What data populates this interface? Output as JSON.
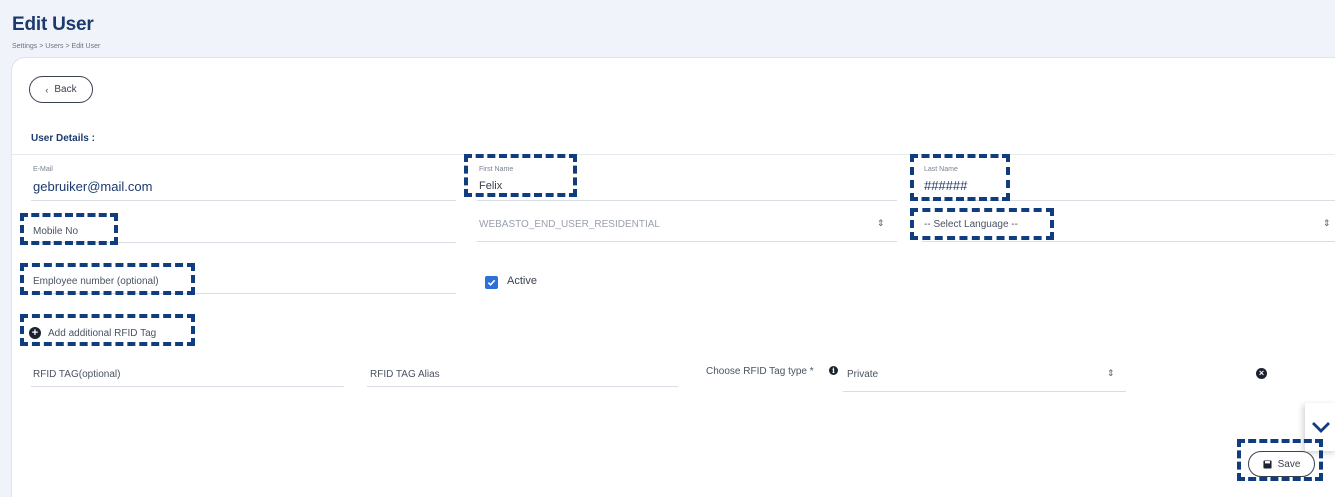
{
  "header": {
    "title": "Edit User",
    "breadcrumb": "Settings > Users > Edit User"
  },
  "toolbar": {
    "back_icon": "chevron-left-icon",
    "back_label": "Back"
  },
  "section": {
    "user_details_title": "User Details :"
  },
  "form": {
    "email": {
      "label": "E-Mail",
      "value": "gebruiker@mail.com"
    },
    "first_name": {
      "label": "First Name",
      "value": "Felix"
    },
    "last_name": {
      "label": "Last Name",
      "value": "######"
    },
    "mobile": {
      "placeholder": "Mobile No"
    },
    "role": {
      "value": "WEBASTO_END_USER_RESIDENTIAL"
    },
    "language": {
      "value": "-- Select Language --"
    },
    "employee_number": {
      "placeholder": "Employee number (optional)"
    },
    "active": {
      "label": "Active",
      "checked": true
    }
  },
  "rfid": {
    "add_label": "Add additional RFID Tag",
    "tag_placeholder": "RFID TAG(optional)",
    "alias_placeholder": "RFID TAG Alias",
    "type_label": "Choose RFID Tag type *",
    "type_value": "Private"
  },
  "actions": {
    "save_label": "Save",
    "scroll_icon": "chevron-down-icon"
  },
  "colors": {
    "title": "#1c3a6e",
    "accent": "#2f6fd6",
    "highlight": "#0f3d80"
  }
}
